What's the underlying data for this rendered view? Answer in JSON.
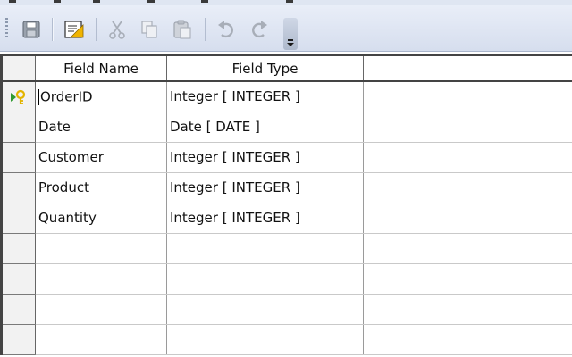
{
  "toolbar": {
    "buttons": [
      {
        "name": "save-icon",
        "enabled": true
      },
      {
        "name": "edit-icon",
        "enabled": true
      },
      {
        "name": "cut-icon",
        "enabled": false
      },
      {
        "name": "copy-icon",
        "enabled": false
      },
      {
        "name": "paste-icon",
        "enabled": false
      },
      {
        "name": "undo-icon",
        "enabled": false
      },
      {
        "name": "redo-icon",
        "enabled": false
      }
    ]
  },
  "table": {
    "columns": {
      "field_name": "Field Name",
      "field_type": "Field Type"
    },
    "rows": [
      {
        "field_name": "OrderID",
        "field_type": "Integer [ INTEGER ]",
        "primary_key": true,
        "current": true
      },
      {
        "field_name": "Date",
        "field_type": "Date [ DATE ]"
      },
      {
        "field_name": "Customer",
        "field_type": "Integer [ INTEGER ]"
      },
      {
        "field_name": "Product",
        "field_type": "Integer [ INTEGER ]"
      },
      {
        "field_name": "Quantity",
        "field_type": "Integer [ INTEGER ]"
      },
      {
        "field_name": "",
        "field_type": ""
      },
      {
        "field_name": "",
        "field_type": ""
      },
      {
        "field_name": "",
        "field_type": ""
      },
      {
        "field_name": "",
        "field_type": ""
      }
    ]
  },
  "colors": {
    "toolbar_bg": "#dfe6f2",
    "key_icon": "#e3b400",
    "current_row_arrow": "#2f9a2f",
    "grid_line": "#c9c9c9"
  }
}
